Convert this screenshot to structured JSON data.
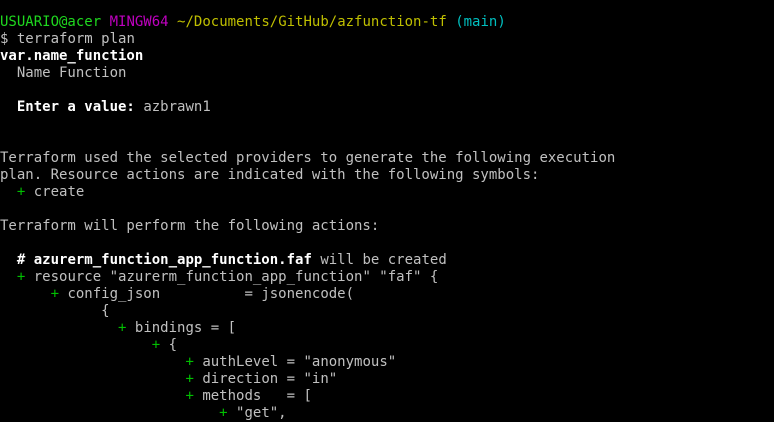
{
  "prompt": {
    "user_host": "USUARIO@acer",
    "system": "MINGW64",
    "path": "~/Documents/GitHub/azfunction-tf",
    "branch": "(main)",
    "dollar": "$",
    "command": "terraform plan"
  },
  "var_prompt": {
    "name": "var.name_function",
    "description": "Name Function",
    "enter_label": "Enter a value:",
    "entered_value": "azbrawn1"
  },
  "output": {
    "used_providers_1": "Terraform used the selected providers to generate the following execution",
    "used_providers_2": "plan. Resource actions are indicated with the following symbols:",
    "plus": "+",
    "create_symbol_label": "create",
    "will_perform": "Terraform will perform the following actions:",
    "hash": "#",
    "resource_addr": "azurerm_function_app_function.faf",
    "will_be_created": "will be created",
    "resource_line": "resource \"azurerm_function_app_function\" \"faf\" {",
    "config_json_line": "config_json          = jsonencode(",
    "open_brace": "{",
    "bindings_line": "bindings = [",
    "auth_level_line": "authLevel = \"anonymous\"",
    "direction_line": "direction = \"in\"",
    "methods_line": "methods   = [",
    "get_line": "\"get\","
  },
  "colors": {
    "background": "#000000",
    "text": "#c0c0c0",
    "bold_text": "#ffffff",
    "user_host": "#1fd81f",
    "system": "#bf00bf",
    "path": "#bfbf00",
    "branch": "#00bfbf",
    "plus": "#00bf00"
  }
}
